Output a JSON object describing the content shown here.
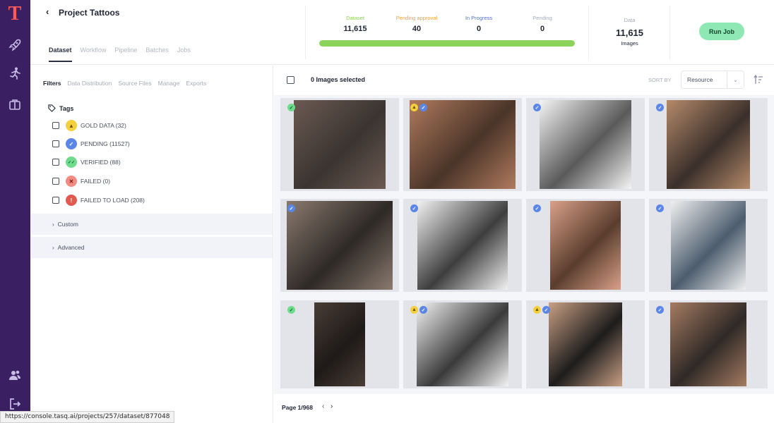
{
  "brand": {
    "logo_letter": "T",
    "logo_color": "#ff5a5a",
    "rail_color": "#3a1f63"
  },
  "rail": {
    "top_icons": [
      "rocket-icon",
      "runner-icon",
      "briefcase-icon"
    ],
    "bottom_icons": [
      "users-icon",
      "logout-icon"
    ]
  },
  "header": {
    "project_title": "Project Tattoos",
    "tabs": [
      {
        "label": "Dataset",
        "active": true
      },
      {
        "label": "Workflow"
      },
      {
        "label": "Pipeline"
      },
      {
        "label": "Batches"
      },
      {
        "label": "Jobs"
      }
    ]
  },
  "stats": [
    {
      "label": "Dataset",
      "value": "11,615",
      "color": "#8cd35a"
    },
    {
      "label": "Pending approval",
      "value": "40",
      "color": "#f0a040"
    },
    {
      "label": "In Progress",
      "value": "0",
      "color": "#4f6fd6"
    },
    {
      "label": "Pending",
      "value": "0",
      "color": "#a6aabb"
    }
  ],
  "progress_fraction": 1.0,
  "data_box": {
    "label": "Data",
    "value": "11,615",
    "sub": "Images"
  },
  "run_job_label": "Run Job",
  "filters": {
    "subtabs": [
      "Filters",
      "Data Distribution",
      "Source Files",
      "Manage",
      "Exports"
    ],
    "tags_title": "Tags",
    "tags": [
      {
        "label": "GOLD DATA (32)",
        "icon": "gold-data-icon",
        "bg": "#f5d03c",
        "fg": "#6b5200",
        "glyph": "▲"
      },
      {
        "label": "PENDING (11527)",
        "icon": "pending-check-icon",
        "bg": "#5b86e8",
        "fg": "#ffffff",
        "glyph": "✓"
      },
      {
        "label": "VERIFIED (88)",
        "icon": "verified-icon",
        "bg": "#6fdc8c",
        "fg": "#125c2a",
        "glyph": "✓✓"
      },
      {
        "label": "FAILED (0)",
        "icon": "failed-icon",
        "bg": "#f28b82",
        "fg": "#7a1a12",
        "glyph": "✕"
      },
      {
        "label": "FAILED TO LOAD (208)",
        "icon": "failed-to-load-icon",
        "bg": "#e05a4f",
        "fg": "#ffffff",
        "glyph": "!"
      }
    ],
    "sections": [
      "Custom",
      "Advanced"
    ]
  },
  "grid": {
    "selected_text": "0 Images selected",
    "sort_label": "SORT BY",
    "sort_value": "Resource",
    "tiles": [
      {
        "name": "tattoo-image-collage-forearm-sleeves",
        "badges": [
          "verified"
        ],
        "tone": [
          "#6b5a52",
          "#3b3430"
        ]
      },
      {
        "name": "tattoo-image-compass-clock-forearm",
        "badges": [
          "gold",
          "pending"
        ],
        "tone": [
          "#b07a5e",
          "#4a3528"
        ]
      },
      {
        "name": "tattoo-image-sleeve-sheet-grid",
        "badges": [
          "pending"
        ],
        "tone": [
          "#f4f4f4",
          "#5a5a5a"
        ]
      },
      {
        "name": "tattoo-image-full-arm-sleeve-man",
        "badges": [
          "pending"
        ],
        "tone": [
          "#b58a6a",
          "#3a2f2a"
        ]
      },
      {
        "name": "tattoo-image-clock-rose-forearm",
        "badges": [
          "pending"
        ],
        "tone": [
          "#8a7a6e",
          "#2e2926"
        ]
      },
      {
        "name": "tattoo-image-arm-sleeves-pair",
        "badges": [
          "pending"
        ],
        "tone": [
          "#f1f1f1",
          "#3e3e3e"
        ]
      },
      {
        "name": "tattoo-image-tribal-band-forearm",
        "badges": [
          "pending"
        ],
        "tone": [
          "#d9a088",
          "#5a3d2e"
        ]
      },
      {
        "name": "tattoo-image-sleeve-catalog-sheet",
        "badges": [
          "pending"
        ],
        "tone": [
          "#efefef",
          "#4d5d6e"
        ]
      },
      {
        "name": "tattoo-image-forearm-lion-closeup",
        "badges": [
          "verified"
        ],
        "tone": [
          "#4a3d36",
          "#1e1a18"
        ]
      },
      {
        "name": "tattoo-image-lion-sleeve-stencil",
        "badges": [
          "gold",
          "pending"
        ],
        "tone": [
          "#f3f3f3",
          "#3a3a3a"
        ]
      },
      {
        "name": "tattoo-image-sleeve-man-black-shirt",
        "badges": [
          "gold",
          "pending"
        ],
        "tone": [
          "#c99f84",
          "#1c1c1c"
        ]
      },
      {
        "name": "tattoo-image-shoulder-clock-sleeve",
        "badges": [
          "pending"
        ],
        "tone": [
          "#a57b62",
          "#2f2926"
        ]
      }
    ]
  },
  "pager": {
    "text": "Page 1/968"
  },
  "status_url": "https://console.tasq.ai/projects/257/dataset/877048"
}
